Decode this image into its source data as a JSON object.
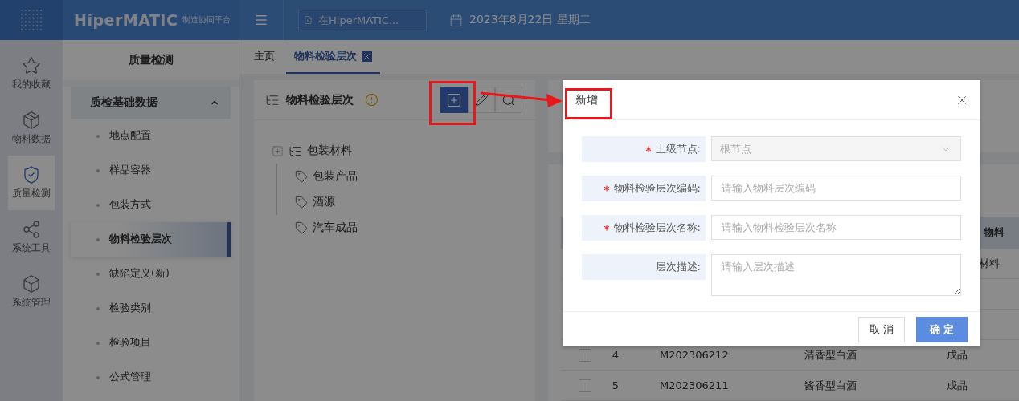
{
  "header": {
    "brand": "HiperMATIC",
    "brand_sub": "制造协同平台",
    "search": {
      "placeholder": "在HiperMATIC..."
    },
    "date": "2023年8月22日 星期二"
  },
  "rail": [
    {
      "label": "我的收藏",
      "selected": false
    },
    {
      "label": "物料数据",
      "selected": false
    },
    {
      "label": "质量检测",
      "selected": true
    },
    {
      "label": "系统工具",
      "selected": false
    },
    {
      "label": "系统管理",
      "selected": false
    }
  ],
  "submenu": {
    "title": "质量检测",
    "group": {
      "label": "质检基础数据",
      "expanded": true,
      "items": [
        {
          "label": "地点配置",
          "selected": false
        },
        {
          "label": "样品容器",
          "selected": false
        },
        {
          "label": "包装方式",
          "selected": false
        },
        {
          "label": "物料检验层次",
          "selected": true
        },
        {
          "label": "缺陷定义(新)",
          "selected": false
        },
        {
          "label": "检验类别",
          "selected": false
        },
        {
          "label": "检验项目",
          "selected": false
        },
        {
          "label": "公式管理",
          "selected": false
        }
      ]
    }
  },
  "tabs": [
    {
      "label": "主页",
      "selected": false,
      "closable": false
    },
    {
      "label": "物料检验层次",
      "selected": true,
      "closable": true
    }
  ],
  "tree_panel": {
    "title": "物料检验层次",
    "tree": [
      {
        "label": "包装材料",
        "kind": "folder",
        "expanded": false,
        "children": [
          {
            "label": "包装产品",
            "kind": "tag"
          },
          {
            "label": "酒源",
            "kind": "tag"
          },
          {
            "label": "汽车成品",
            "kind": "tag"
          }
        ]
      }
    ]
  },
  "table": {
    "header_last": "物料",
    "rows": [
      {
        "type": "材料"
      },
      {
        "index": "4",
        "code": "M202306212",
        "name": "清香型白酒",
        "type": "成品",
        "checked": false
      },
      {
        "index": "5",
        "code": "M202306211",
        "name": "酱香型白酒",
        "type": "成品",
        "checked": false
      }
    ]
  },
  "dialog": {
    "title": "新增",
    "fields": [
      {
        "label": "上级节点:",
        "required": true,
        "kind": "select",
        "value": "根节点",
        "disabled": true
      },
      {
        "label": "物料检验层次编码:",
        "required": true,
        "kind": "input",
        "placeholder": "请输入物料层次编码"
      },
      {
        "label": "物料检验层次名称:",
        "required": true,
        "kind": "input",
        "placeholder": "请输入物料检验层次名称"
      },
      {
        "label": "层次描述:",
        "required": false,
        "kind": "textarea",
        "placeholder": "请输入层次描述"
      }
    ],
    "buttons": [
      {
        "label": "取 消",
        "kind": "secondary"
      },
      {
        "label": "确 定",
        "kind": "primary"
      }
    ]
  }
}
